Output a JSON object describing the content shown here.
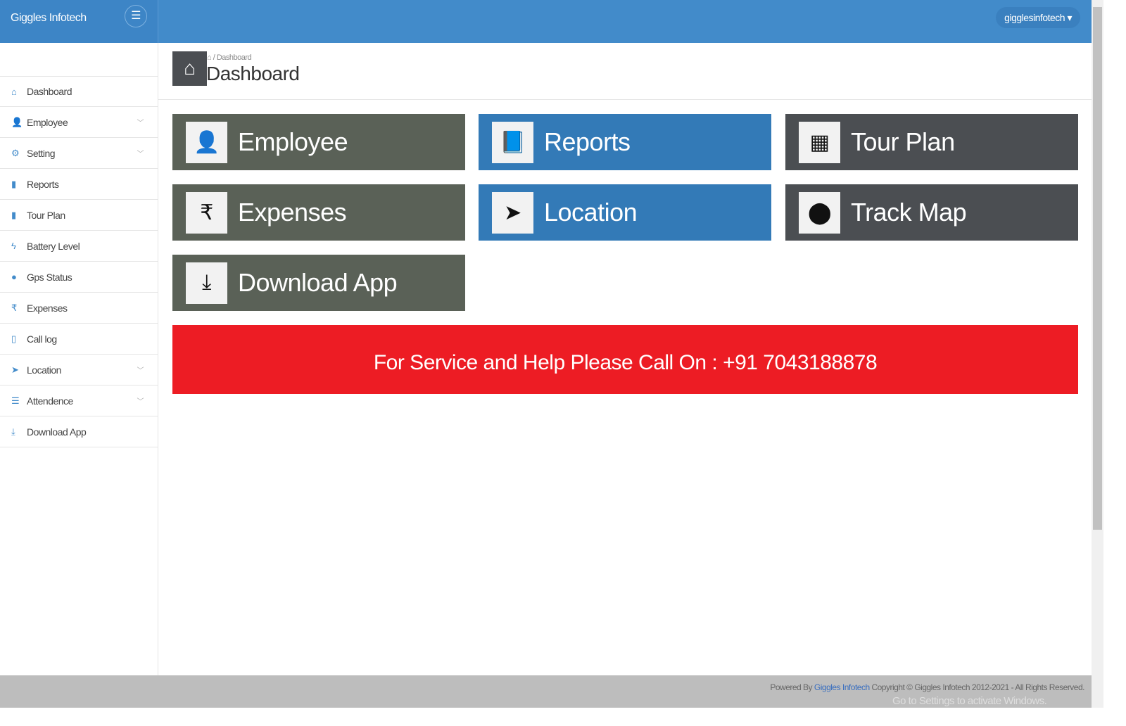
{
  "header": {
    "brand": "Giggles Infotech",
    "user": "gigglesinfotech"
  },
  "sidebar": {
    "items": [
      {
        "label": "Dashboard",
        "icon": "home-icon",
        "glyph": "⌂",
        "chev": false
      },
      {
        "label": "Employee",
        "icon": "user-icon",
        "glyph": "👤",
        "chev": true
      },
      {
        "label": "Setting",
        "icon": "gear-icon",
        "glyph": "⚙",
        "chev": true
      },
      {
        "label": "Reports",
        "icon": "file-icon",
        "glyph": "▮",
        "chev": false
      },
      {
        "label": "Tour Plan",
        "icon": "book-icon",
        "glyph": "▮",
        "chev": false
      },
      {
        "label": "Battery Level",
        "icon": "bolt-icon",
        "glyph": "ϟ",
        "chev": false
      },
      {
        "label": "Gps Status",
        "icon": "map-marker-icon",
        "glyph": "●",
        "chev": false
      },
      {
        "label": "Expenses",
        "icon": "rupee-icon",
        "glyph": "₹",
        "chev": false
      },
      {
        "label": "Call log",
        "icon": "mobile-icon",
        "glyph": "▯",
        "chev": false
      },
      {
        "label": "Location",
        "icon": "location-arrow-icon",
        "glyph": "➤",
        "chev": true
      },
      {
        "label": "Attendence",
        "icon": "list-icon",
        "glyph": "☰",
        "chev": true
      },
      {
        "label": "Download App",
        "icon": "download-icon",
        "glyph": "⤓",
        "chev": false
      }
    ]
  },
  "page": {
    "breadcrumb": "Dashboard",
    "title": "Dashboard"
  },
  "tiles": [
    {
      "label": "Employee",
      "icon": "user-icon",
      "glyph": "👤",
      "color": "#5a6157"
    },
    {
      "label": "Reports",
      "icon": "book-icon",
      "glyph": "📘",
      "color": "#337ab7"
    },
    {
      "label": "Tour Plan",
      "icon": "table-icon",
      "glyph": "▦",
      "color": "#4b4e52"
    },
    {
      "label": "Expenses",
      "icon": "rupee-icon",
      "glyph": "₹",
      "color": "#5a6157"
    },
    {
      "label": "Location",
      "icon": "location-arrow-icon",
      "glyph": "➤",
      "color": "#337ab7"
    },
    {
      "label": "Track Map",
      "icon": "map-marker-icon",
      "glyph": "⬤",
      "color": "#4b4e52"
    },
    {
      "label": "Download App",
      "icon": "download-icon",
      "glyph": "⤓",
      "color": "#5a6157"
    }
  ],
  "help": {
    "text": "For Service and Help Please Call On : +91 7043188878",
    "color": "#ed1c24"
  },
  "footer": {
    "prefix": "Powered By",
    "link": "Giggles Infotech",
    "suffix": "Copyright © Giggles Infotech 2012-2021 - All Rights Reserved."
  },
  "watermark": "Go to Settings to activate Windows."
}
